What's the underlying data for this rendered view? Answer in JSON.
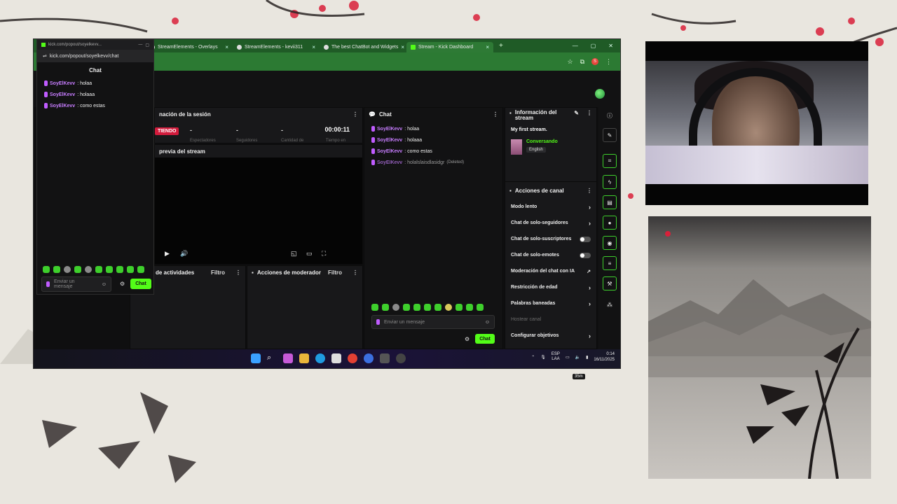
{
  "browser": {
    "tabs": [
      {
        "label": "StreamElements - Overlays",
        "favicon": "streamelements-icon"
      },
      {
        "label": "StreamElements - kevii311",
        "favicon": "streamelements-icon"
      },
      {
        "label": "The best ChatBot and Widgets",
        "favicon": "botrix-icon"
      },
      {
        "label": "Stream - Kick Dashboard",
        "favicon": "kick-icon",
        "active": true
      }
    ],
    "new_tab": "+",
    "profile_initial": "S"
  },
  "popout": {
    "tab_label": "kick.com/popout/soyelkevv...",
    "url": "kick.com/popout/soyelkevv/chat",
    "title": "Chat",
    "messages": [
      {
        "user": "SoyElKevv",
        "text": ": holaa"
      },
      {
        "user": "SoyElKevv",
        "text": ": holaaa"
      },
      {
        "user": "SoyElKevv",
        "text": ": como estas"
      }
    ],
    "input_placeholder": "Enviar un mensaje",
    "send_label": "Chat"
  },
  "session": {
    "title": "nación de la sesión",
    "live_badge": "TIENDO",
    "stats": [
      "-",
      "-",
      "-"
    ],
    "stat_labels": [
      "Espectadores",
      "Seguidores",
      "Cantidad de"
    ],
    "timer": "00:00:11",
    "timer_label": "Tiempo en"
  },
  "preview": {
    "title": "previa del stream"
  },
  "activity": {
    "title": "de actividades",
    "filter": "Filtro"
  },
  "mod_actions": {
    "title": "Acciones de moderador",
    "filter": "Filtro"
  },
  "chat": {
    "title": "Chat",
    "messages": [
      {
        "user": "SoyElKevv",
        "text": ": holaa",
        "deleted": ""
      },
      {
        "user": "SoyElKevv",
        "text": ": holaaa",
        "deleted": ""
      },
      {
        "user": "SoyElKevv",
        "text": ": como estas",
        "deleted": ""
      },
      {
        "user": "SoyElKevv",
        "text": ": holalslaisdlasidgr",
        "deleted": "(Deleted)"
      }
    ],
    "input_placeholder": "Enviar un mensaje",
    "send_label": "Chat"
  },
  "stream_info": {
    "title": "Información del stream",
    "stream_title": "My first stream.",
    "category": "Conversando",
    "language": "English"
  },
  "channel_actions": {
    "title": "Acciones de canal",
    "items": [
      {
        "label": "Modo lento",
        "kind": "chevron"
      },
      {
        "label": "Chat de solo-seguidores",
        "kind": "chevron"
      },
      {
        "label": "Chat de solo-suscriptores",
        "kind": "toggle"
      },
      {
        "label": "Chat de solo-emotes",
        "kind": "toggle"
      },
      {
        "label": "Moderación del chat con IA",
        "kind": "external"
      },
      {
        "label": "Restricción de edad",
        "kind": "chevron"
      },
      {
        "label": "Palabras baneadas",
        "kind": "chevron"
      },
      {
        "label": "Hostear canal",
        "kind": "muted"
      },
      {
        "label": "Configurar objetivos",
        "kind": "chevron"
      }
    ]
  },
  "taskbar": {
    "lang_top": "ESP",
    "lang_bottom": "LAA",
    "time": "0:14",
    "date": "16/11/2025"
  },
  "floating_label": "35m",
  "colors": {
    "kick_green": "#53fc18",
    "live_red": "#d21b3c",
    "username": "#c77dff"
  }
}
